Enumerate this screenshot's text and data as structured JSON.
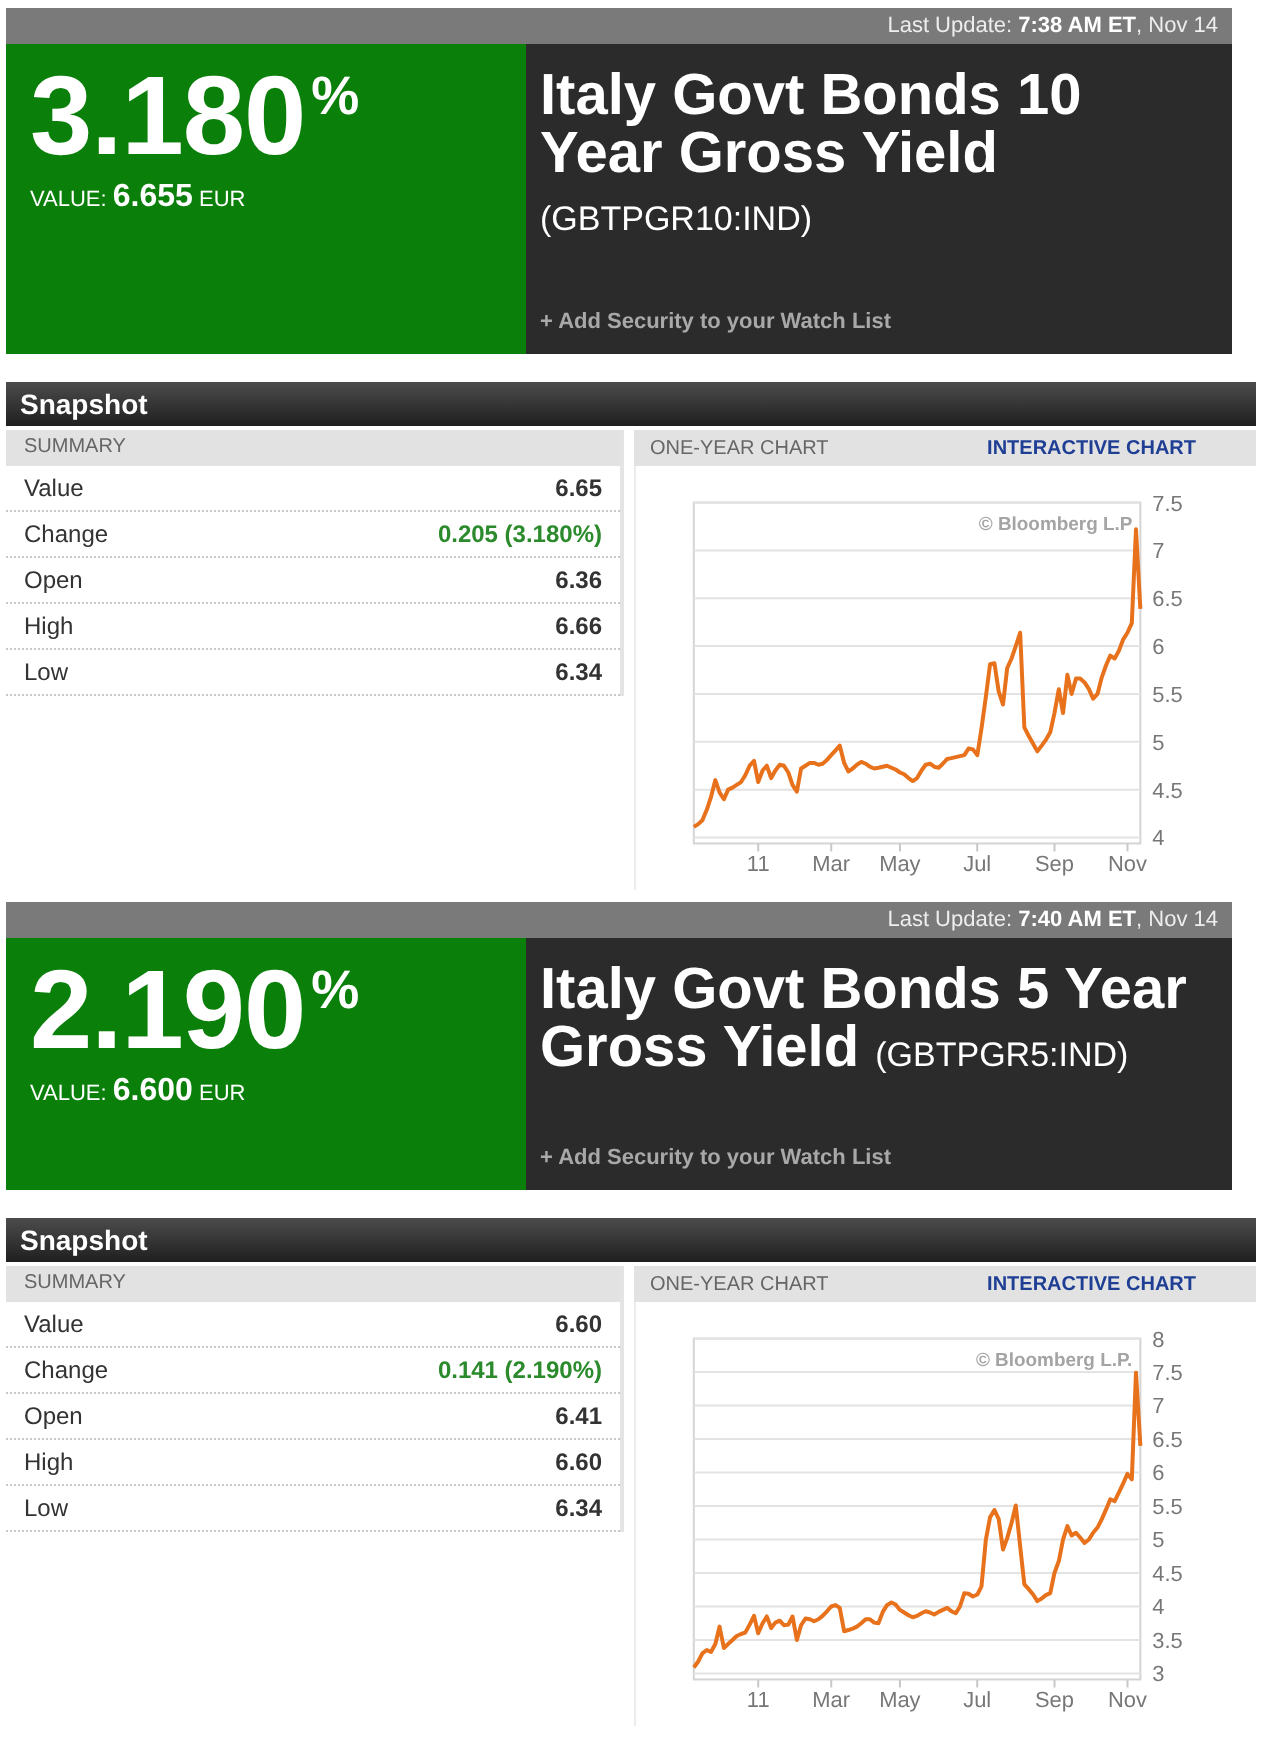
{
  "quotes": [
    {
      "last_update": "Last Update: **7:38 AM ET**, Nov 14",
      "positive": true,
      "change_percent": "3.180$^{%}$",
      "value_line": "VALUE: **6.655** EUR",
      "title": "Italy Govt Bonds 10 Year Gross Yield",
      "ticker": "(GBTPGR10:IND)",
      "watch_link": "+ Add Security to your Watch List",
      "snapshot": {
        "heading": "Snapshot",
        "summary_heading": "SUMMARY",
        "rows": [
          {
            "label": "Value",
            "value": "6.65"
          },
          {
            "label": "Change",
            "value": "0.205 (3.180%)",
            "positive": true
          },
          {
            "label": "Open",
            "value": "6.36"
          },
          {
            "label": "High",
            "value": "6.66"
          },
          {
            "label": "Low",
            "value": "6.34"
          }
        ]
      },
      "chart": {
        "heading": "ONE-YEAR CHART",
        "link": "INTERACTIVE CHART",
        "credit": "© Bloomberg L.P",
        "chart_data": {
          "type": "line",
          "grid": true,
          "categories": [
            null,
            null,
            null,
            null,
            null,
            null,
            null,
            null,
            null,
            null,
            null,
            null,
            null,
            null,
            null,
            "11",
            null,
            null,
            null,
            null,
            null,
            null,
            null,
            null,
            null,
            null,
            null,
            null,
            null,
            null,
            null,
            null,
            "Mar",
            null,
            null,
            null,
            null,
            null,
            null,
            null,
            null,
            null,
            null,
            null,
            null,
            null,
            null,
            null,
            "May",
            null,
            null,
            null,
            null,
            null,
            null,
            null,
            null,
            null,
            null,
            null,
            null,
            null,
            null,
            null,
            null,
            null,
            "Jul",
            null,
            null,
            null,
            null,
            null,
            null,
            null,
            null,
            null,
            null,
            null,
            null,
            null,
            null,
            null,
            null,
            null,
            "Sep",
            null,
            null,
            null,
            null,
            null,
            null,
            null,
            null,
            null,
            null,
            null,
            null,
            null,
            null,
            null,
            null,
            "Nov",
            null,
            null,
            null
          ],
          "values": [
            4.11,
            4.14,
            4.18,
            4.29,
            4.42,
            4.6,
            4.47,
            4.4,
            4.5,
            4.52,
            4.55,
            4.58,
            4.65,
            4.75,
            4.8,
            4.58,
            4.7,
            4.75,
            4.62,
            4.7,
            4.76,
            4.75,
            4.68,
            4.55,
            4.48,
            4.72,
            4.75,
            4.78,
            4.78,
            4.76,
            4.77,
            4.81,
            4.86,
            4.91,
            4.96,
            4.78,
            4.69,
            4.72,
            4.76,
            4.79,
            4.77,
            4.74,
            4.72,
            4.73,
            4.74,
            4.75,
            4.73,
            4.71,
            4.68,
            4.66,
            4.62,
            4.59,
            4.62,
            4.7,
            4.76,
            4.77,
            4.74,
            4.73,
            4.77,
            4.82,
            4.83,
            4.84,
            4.85,
            4.86,
            4.93,
            4.92,
            4.86,
            5.14,
            5.47,
            5.81,
            5.82,
            5.53,
            5.39,
            5.77,
            5.87,
            6.0,
            6.14,
            5.15,
            5.06,
            4.98,
            4.9,
            4.96,
            5.02,
            5.1,
            5.3,
            5.55,
            5.3,
            5.7,
            5.5,
            5.66,
            5.66,
            5.62,
            5.55,
            5.45,
            5.5,
            5.67,
            5.8,
            5.9,
            5.87,
            5.95,
            6.07,
            6.14,
            6.24,
            7.22,
            6.39
          ],
          "ylim": [
            4,
            7.5
          ],
          "yticks": [
            4,
            4.5,
            5,
            5.5,
            6,
            6.5,
            7,
            7.5
          ]
        }
      }
    },
    {
      "last_update": "Last Update: **7:40 AM ET**, Nov 14",
      "positive": true,
      "change_percent": "2.190$^{%}$",
      "value_line": "VALUE: **6.600** EUR",
      "title": "Italy Govt Bonds 5 Year Gross Yield",
      "ticker": "(GBTPGR5:IND)",
      "watch_link": "+ Add Security to your Watch List",
      "snapshot": {
        "heading": "Snapshot",
        "summary_heading": "SUMMARY",
        "rows": [
          {
            "label": "Value",
            "value": "6.60"
          },
          {
            "label": "Change",
            "value": "0.141 (2.190%)",
            "positive": true
          },
          {
            "label": "Open",
            "value": "6.41"
          },
          {
            "label": "High",
            "value": "6.60"
          },
          {
            "label": "Low",
            "value": "6.34"
          }
        ]
      },
      "chart": {
        "heading": "ONE-YEAR CHART",
        "link": "INTERACTIVE CHART",
        "credit": "© Bloomberg L.P.",
        "chart_data": {
          "type": "line",
          "grid": true,
          "categories": [
            null,
            null,
            null,
            null,
            null,
            null,
            null,
            null,
            null,
            null,
            null,
            null,
            null,
            null,
            null,
            "11",
            null,
            null,
            null,
            null,
            null,
            null,
            null,
            null,
            null,
            null,
            null,
            null,
            null,
            null,
            null,
            null,
            "Mar",
            null,
            null,
            null,
            null,
            null,
            null,
            null,
            null,
            null,
            null,
            null,
            null,
            null,
            null,
            null,
            "May",
            null,
            null,
            null,
            null,
            null,
            null,
            null,
            null,
            null,
            null,
            null,
            null,
            null,
            null,
            null,
            null,
            null,
            "Jul",
            null,
            null,
            null,
            null,
            null,
            null,
            null,
            null,
            null,
            null,
            null,
            null,
            null,
            null,
            null,
            null,
            null,
            "Sep",
            null,
            null,
            null,
            null,
            null,
            null,
            null,
            null,
            null,
            null,
            null,
            null,
            null,
            null,
            null,
            null,
            "Nov",
            null,
            null,
            null
          ],
          "values": [
            3.09,
            3.18,
            3.3,
            3.35,
            3.32,
            3.44,
            3.7,
            3.38,
            3.44,
            3.5,
            3.56,
            3.59,
            3.61,
            3.73,
            3.86,
            3.6,
            3.75,
            3.85,
            3.68,
            3.76,
            3.79,
            3.72,
            3.73,
            3.85,
            3.5,
            3.72,
            3.82,
            3.81,
            3.78,
            3.81,
            3.86,
            3.93,
            4.0,
            4.02,
            3.98,
            3.63,
            3.65,
            3.67,
            3.7,
            3.75,
            3.81,
            3.81,
            3.76,
            3.75,
            3.92,
            4.02,
            4.06,
            4.03,
            3.95,
            3.91,
            3.87,
            3.84,
            3.86,
            3.9,
            3.93,
            3.91,
            3.88,
            3.92,
            3.95,
            3.98,
            3.93,
            3.9,
            4.0,
            4.2,
            4.19,
            4.15,
            4.18,
            4.3,
            5.0,
            5.33,
            5.44,
            5.31,
            4.85,
            5.02,
            5.25,
            5.51,
            4.9,
            4.33,
            4.26,
            4.18,
            4.08,
            4.12,
            4.17,
            4.2,
            4.5,
            4.68,
            5.0,
            5.2,
            5.06,
            5.1,
            5.03,
            4.95,
            5.0,
            5.1,
            5.18,
            5.3,
            5.45,
            5.6,
            5.57,
            5.7,
            5.84,
            5.98,
            5.9,
            7.49,
            6.4
          ],
          "ylim": [
            3,
            8
          ],
          "yticks": [
            3,
            3.5,
            4,
            4.5,
            5,
            5.5,
            6,
            6.5,
            7,
            7.5,
            8
          ]
        }
      }
    }
  ]
}
